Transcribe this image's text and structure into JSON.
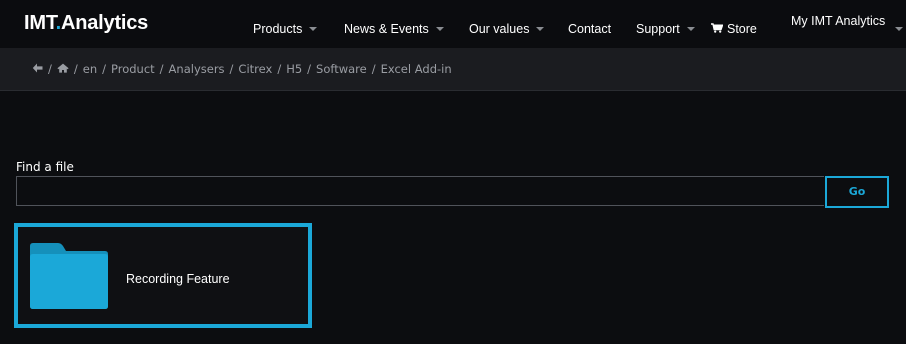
{
  "header": {
    "logo_main": "IMT",
    "logo_dot": ".",
    "logo_rest": "Analytics",
    "nav": [
      {
        "label": "Products",
        "has_dropdown": true
      },
      {
        "label": "News & Events",
        "has_dropdown": true
      },
      {
        "label": "Our values",
        "has_dropdown": true
      },
      {
        "label": "Contact",
        "has_dropdown": false
      },
      {
        "label": "Support",
        "has_dropdown": true
      },
      {
        "label": "Store",
        "icon": "cart-icon"
      },
      {
        "label": "My IMT Analytics",
        "has_dropdown": true
      }
    ]
  },
  "breadcrumb": {
    "items": [
      "en",
      "Product",
      "Analysers",
      "Citrex",
      "H5",
      "Software",
      "Excel Add-in"
    ],
    "icons": [
      "back-arrow-icon",
      "home-icon"
    ],
    "separator": "/"
  },
  "search": {
    "label": "Find a file",
    "value": "",
    "placeholder": "",
    "button_label": "Go"
  },
  "folders": [
    {
      "name": "Recording Feature",
      "icon": "folder-icon",
      "selected": true
    }
  ],
  "colors": {
    "accent": "#1ba8d8",
    "background": "#0c0d10",
    "breadcrumb_bg": "#1b1c20",
    "folder": "#1ba8d8"
  }
}
